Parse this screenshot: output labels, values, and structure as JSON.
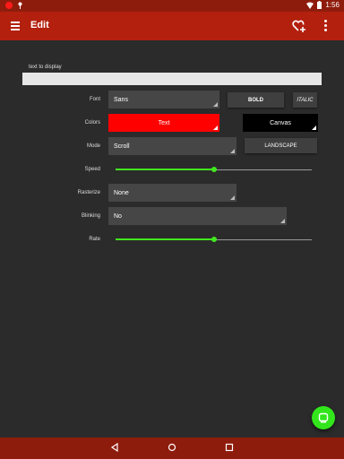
{
  "status_bar": {
    "time": "1:56",
    "icons": [
      "record-dot-icon",
      "notification-icon",
      "wifi-icon",
      "battery-icon"
    ]
  },
  "app_bar": {
    "title": "Edit",
    "icons": [
      "menu-icon",
      "favorite-add-icon",
      "overflow-menu-icon"
    ]
  },
  "text_field": {
    "label": "text to display",
    "value": ""
  },
  "font": {
    "label": "Font",
    "value": "Sans",
    "bold_label": "BOLD",
    "italic_label": "ITALIC"
  },
  "colors": {
    "label": "Colors",
    "text_label": "Text",
    "text_color": "#ff0000",
    "canvas_label": "Canvas",
    "canvas_color": "#000000"
  },
  "mode": {
    "label": "Mode",
    "value": "Scroll",
    "landscape_label": "LANDSCAPE"
  },
  "speed": {
    "label": "Speed",
    "value": 0.5
  },
  "rasterize": {
    "label": "Rasterize",
    "value": "None"
  },
  "blinking": {
    "label": "Blinking",
    "value": "No"
  },
  "rate": {
    "label": "Rate",
    "value": 0.5
  },
  "theme": {
    "accent": "#41e81f",
    "app_bar": "#b3200e",
    "status_bar": "#8e1c0c"
  }
}
